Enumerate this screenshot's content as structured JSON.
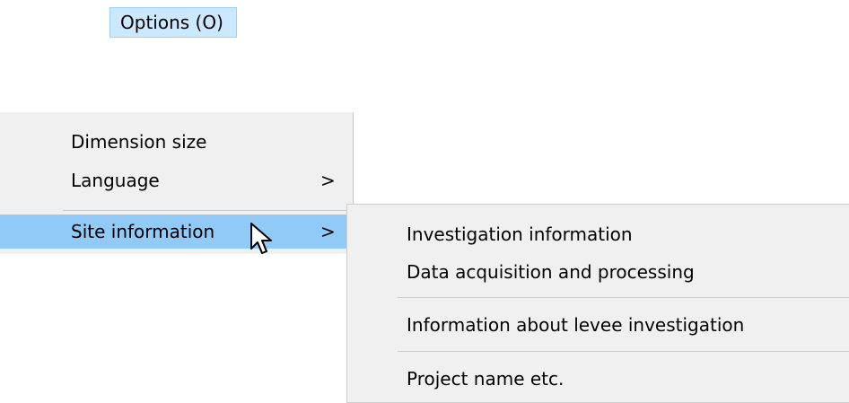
{
  "menubar": {
    "options_label": "Options (O)"
  },
  "options_menu": {
    "items": [
      {
        "label": "Dimension size",
        "has_submenu": false
      },
      {
        "label": "Language",
        "has_submenu": true,
        "arrow": ">"
      },
      {
        "label": "Site information",
        "has_submenu": true,
        "arrow": ">",
        "highlighted": true
      }
    ]
  },
  "site_information_submenu": {
    "items": [
      {
        "label": "Investigation information"
      },
      {
        "label": "Data acquisition and processing"
      },
      {
        "label": "Information about levee investigation"
      },
      {
        "label": "Project name etc."
      }
    ]
  },
  "colors": {
    "highlight": "#91c9f7",
    "menu_background": "#f0f0f0",
    "title_highlight": "#cce8ff"
  },
  "icons": {
    "cursor": "mouse-pointer-icon",
    "submenu_arrow": "chevron-right-icon"
  }
}
